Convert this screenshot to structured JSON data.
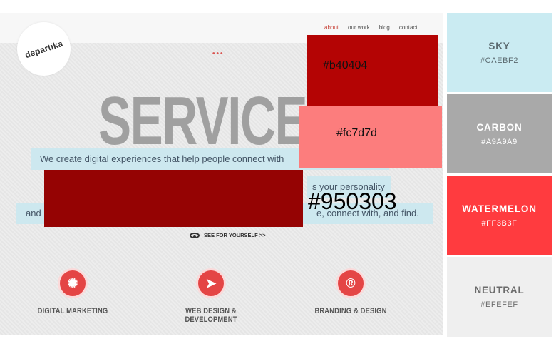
{
  "site": {
    "nav": [
      "about",
      "our work",
      "blog",
      "contact"
    ],
    "logo_text": "departika",
    "dots": "•••",
    "hero_title": "SERVICE",
    "taglines": [
      "We create digital experiences that help people connect with",
      "s your personality",
      "and",
      "e, connect with, and find."
    ],
    "see_link": "SEE FOR YOURSELF >>",
    "services": [
      {
        "label": "DIGITAL MARKETING",
        "icon": "network-icon",
        "glyph": "✺"
      },
      {
        "label": "WEB DESIGN & DEVELOPMENT",
        "icon": "cursor-icon",
        "glyph": "➤"
      },
      {
        "label": "BRANDING & DESIGN",
        "icon": "registered-icon",
        "glyph": "®"
      }
    ]
  },
  "overlays": [
    {
      "label": "#b40404",
      "color": "#b40404"
    },
    {
      "label": "#fc7d7d",
      "color": "#fc7d7d"
    },
    {
      "label": "#950303",
      "color": "#950303"
    }
  ],
  "palette": [
    {
      "name": "SKY",
      "hex": "#CAEBF2"
    },
    {
      "name": "CARBON",
      "hex": "#A9A9A9"
    },
    {
      "name": "WATERMELON",
      "hex": "#FF3B3F"
    },
    {
      "name": "NEUTRAL",
      "hex": "#EFEFEF"
    }
  ]
}
